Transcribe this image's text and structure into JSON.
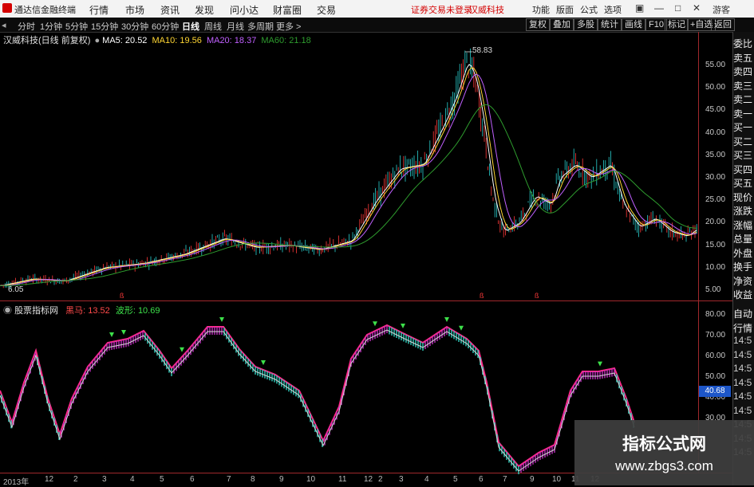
{
  "menubar": {
    "app_title": "通达信金融终端",
    "menus": [
      "行情",
      "市场",
      "资讯",
      "发现",
      "问小达",
      "财富圈",
      "交易"
    ],
    "notice": "证券交易未登录",
    "stock": "汉威科技",
    "right_menus": [
      "功能",
      "版面",
      "公式",
      "选项"
    ],
    "guest": "游客"
  },
  "toolbar": {
    "tabs": [
      "分时",
      "1分钟",
      "5分钟",
      "15分钟",
      "30分钟",
      "60分钟",
      "日线",
      "周线",
      "月线",
      "多周期",
      "更多 >"
    ],
    "active": "日线",
    "right_tabs": [
      "复权",
      "叠加",
      "多股",
      "统计",
      "画线",
      "F10",
      "标记",
      "+自选",
      "返回"
    ]
  },
  "price_pane": {
    "name": "汉威科技(日线 前复权)",
    "ma5_label": "MA5: 20.52",
    "ma10_label": "MA10: 19.56",
    "ma20_label": "MA20: 18.37",
    "ma60_label": "MA60: 21.18",
    "high_label": "58.83",
    "low_label": "6.05",
    "axis_ticks": [
      "55.00",
      "50.00",
      "45.00",
      "40.00",
      "35.00",
      "30.00",
      "25.00",
      "20.00",
      "15.00",
      "10.00",
      "5.00"
    ],
    "colors": {
      "ma5": "#ffffff",
      "ma10": "#ffd633",
      "ma20": "#c060ff",
      "ma60": "#2e9c2e",
      "up": "#ff3a3a",
      "down": "#2ad0d0"
    }
  },
  "indicator_pane": {
    "name": "股票指标网",
    "black_horse_label": "黑马: 13.52",
    "wave_label": "波形: 10.69",
    "axis_ticks": [
      "80.00",
      "70.00",
      "60.00",
      "50.00",
      "40.00",
      "30.00"
    ],
    "current_value": "40.68"
  },
  "x_axis": [
    "2013年",
    "12",
    "2",
    "3",
    "4",
    "5",
    "6",
    "7",
    "8",
    "9",
    "10",
    "11",
    "12",
    "2",
    "3",
    "4",
    "5",
    "6",
    "7",
    "9",
    "10",
    "11",
    "12"
  ],
  "sidebar": {
    "items": [
      "委比",
      "卖五",
      "卖四",
      "卖三",
      "卖二",
      "卖一",
      "买一",
      "买二",
      "买三",
      "买四",
      "买五",
      "现价",
      "涨跌",
      "涨幅",
      "总量",
      "外盘",
      "换手",
      "净资",
      "收益"
    ],
    "lower_items": [
      "自动",
      "行情",
      "14:5",
      "14:5",
      "14:5",
      "14:5",
      "14:5",
      "14:5",
      "14:5",
      "14:5",
      "14:5"
    ]
  },
  "watermark": {
    "line1": "指标公式网",
    "line2": "www.zbgs3.com"
  }
}
